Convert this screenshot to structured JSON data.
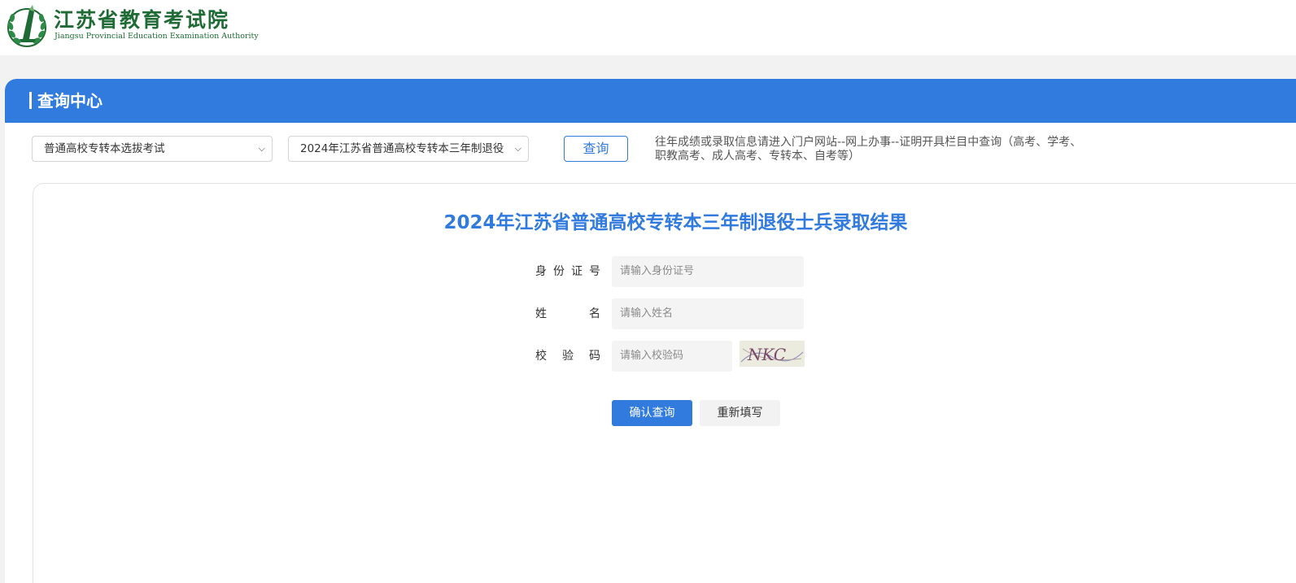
{
  "header": {
    "org_name_cn": "江苏省教育考试院",
    "org_name_en": "Jiangsu Provincial Education Examination Authority",
    "logo_icon": "emblem-logo-icon",
    "brand_color": "#1f6b35"
  },
  "panel": {
    "title": "查询中心",
    "accent_color": "#317ade"
  },
  "filters": {
    "exam_select": "普通高校专转本选拔考试",
    "project_select": "2024年江苏省普通高校专转本三年制退役",
    "query_button": "查询",
    "notice": "往年成绩或录取信息请进入门户网站--网上办事--证明开具栏目中查询（高考、学考、职教高考、成人高考、专转本、自考等）"
  },
  "form": {
    "title": "2024年江苏省普通高校专转本三年制退役士兵录取结果",
    "fields": [
      {
        "label": "身份证号",
        "placeholder": "请输入身份证号"
      },
      {
        "label": "姓名",
        "placeholder": "请输入姓名"
      },
      {
        "label": "校验码",
        "placeholder": "请输入校验码"
      }
    ],
    "captcha_text": "NKC",
    "confirm_button": "确认查询",
    "reset_button": "重新填写"
  }
}
